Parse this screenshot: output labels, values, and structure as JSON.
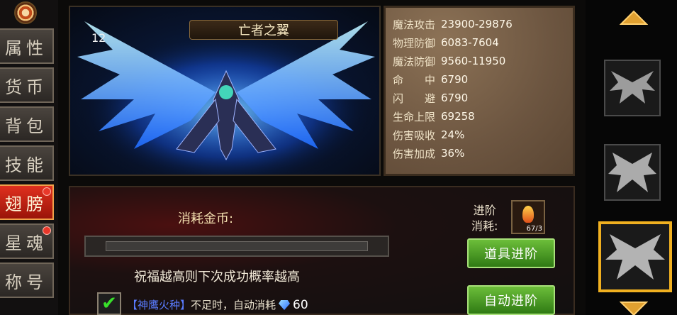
{
  "nav": {
    "items": [
      {
        "label": "属性",
        "active": false,
        "badge": false
      },
      {
        "label": "货币",
        "active": false,
        "badge": false
      },
      {
        "label": "背包",
        "active": false,
        "badge": false
      },
      {
        "label": "技能",
        "active": false,
        "badge": false
      },
      {
        "label": "翅膀",
        "active": true,
        "badge": true
      },
      {
        "label": "星魂",
        "active": false,
        "badge": true
      },
      {
        "label": "称号",
        "active": false,
        "badge": false
      }
    ]
  },
  "wing": {
    "name": "亡者之翼",
    "level": "12"
  },
  "stats": [
    {
      "name": "魔法攻击",
      "value": "23900-29876"
    },
    {
      "name": "物理防御",
      "value": "6083-7604"
    },
    {
      "name": "魔法防御",
      "value": "9560-11950"
    },
    {
      "name": "命　　中",
      "value": "6790"
    },
    {
      "name": "闪　　避",
      "value": "6790"
    },
    {
      "name": "生命上限",
      "value": "69258"
    },
    {
      "name": "伤害吸收",
      "value": "24%"
    },
    {
      "name": "伤害加成",
      "value": "36%"
    }
  ],
  "upgrade": {
    "cost_label": "消耗金币:",
    "progress": 0,
    "bless_text": "祝福越高则下次成功概率越高",
    "auto_item": "【神鹰火种】",
    "auto_text": "不足时，自动消耗",
    "gem_count": "60",
    "advance_label_1": "进阶",
    "advance_label_2": "消耗:",
    "advance_item_count": "67/3",
    "item_advance_button": "道具进阶",
    "auto_advance_button": "自动进阶"
  },
  "colors": {
    "accent_gold": "#f0b020",
    "active_tab": "#e0301e",
    "button_green": "#4e9e26"
  }
}
